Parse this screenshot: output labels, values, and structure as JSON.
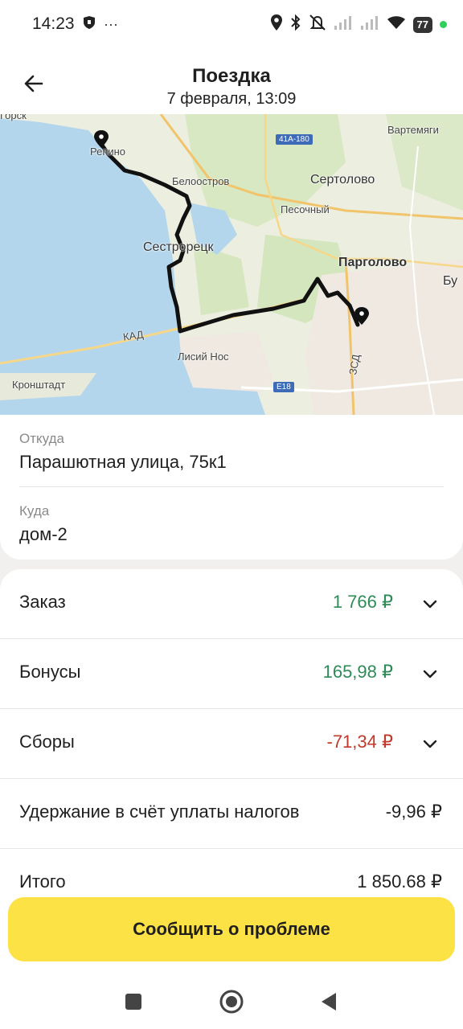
{
  "status_bar": {
    "time": "14:23",
    "dots": "···",
    "battery": "77",
    "left_icons": [
      "shield-icon"
    ],
    "right_icons": [
      "location-icon",
      "bluetooth-icon",
      "mute-icon",
      "signal-icon",
      "signal-icon",
      "wifi-icon"
    ]
  },
  "header": {
    "title": "Поездка",
    "subtitle": "7 февраля, 13:09",
    "back_icon": "arrow-left-icon"
  },
  "map": {
    "labels": {
      "repino": "Репино",
      "beloostrov": "Белоостров",
      "sertolovo": "Сертолово",
      "vartemyagi": "Вартемяги",
      "pesochny": "Песочный",
      "sestroretsk": "Сестрорецк",
      "pargolovo": "Парголово",
      "lisiy_nos": "Лисий Нос",
      "kad": "КАД",
      "kronshtadt": "Кронштадт",
      "zsd": "ЗСД",
      "bu": "Бу",
      "gorsk": "Горск"
    },
    "road_badges": {
      "a180": "41A-180",
      "e18": "E18"
    },
    "colors": {
      "water": "#b4d6ec",
      "land": "#eceee0",
      "route": "#111111"
    }
  },
  "addresses": {
    "from_label": "Откуда",
    "from_value": "Парашютная улица, 75к1",
    "to_label": "Куда",
    "to_value": "дом-2"
  },
  "payments": {
    "order": {
      "label": "Заказ",
      "amount": "1 766 ₽",
      "color": "#2e8b57"
    },
    "bonuses": {
      "label": "Бонусы",
      "amount": "165,98 ₽",
      "color": "#2e8b57"
    },
    "fees": {
      "label": "Сборы",
      "amount": "-71,34 ₽",
      "color": "#c0392b"
    },
    "tax": {
      "label": "Удержание в счёт уплаты налогов",
      "amount": "-9,96 ₽"
    },
    "total": {
      "label": "Итого",
      "amount": "1 850,68 ₽"
    }
  },
  "report_button": {
    "label": "Сообщить о проблеме",
    "color": "#fce245"
  },
  "nav": {
    "icons": [
      "square-icon",
      "home-circle-icon",
      "back-triangle-icon"
    ]
  }
}
